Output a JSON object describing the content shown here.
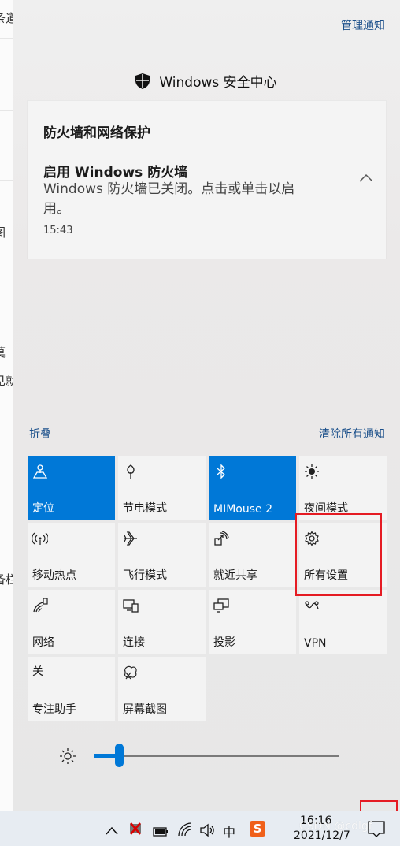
{
  "background_window": {
    "fragments": [
      "条道",
      "图",
      "莫",
      "见就",
      "备栏"
    ]
  },
  "header": {
    "manage_label": "管理通知"
  },
  "security": {
    "app_title": "Windows 安全中心",
    "card_title": "防火墙和网络保护",
    "notification": {
      "title": "启用 Windows 防火墙",
      "body": "Windows 防火墙已关闭。点击或单击以启用。",
      "time": "15:43"
    }
  },
  "actions": {
    "collapse_label": "折叠",
    "clear_label": "清除所有通知"
  },
  "quick_actions": [
    {
      "label": "定位",
      "icon": "location-icon",
      "active": true
    },
    {
      "label": "节电模式",
      "icon": "battery-saver-icon",
      "active": false
    },
    {
      "label": "MIMouse 2",
      "icon": "bluetooth-icon",
      "active": true
    },
    {
      "label": "夜间模式",
      "icon": "night-light-icon",
      "active": false
    },
    {
      "label": "移动热点",
      "icon": "mobile-hotspot-icon",
      "active": false
    },
    {
      "label": "飞行模式",
      "icon": "airplane-icon",
      "active": false
    },
    {
      "label": "就近共享",
      "icon": "nearby-share-icon",
      "active": false
    },
    {
      "label": "所有设置",
      "icon": "gear-icon",
      "active": false
    },
    {
      "label": "网络",
      "icon": "network-icon",
      "active": false
    },
    {
      "label": "连接",
      "icon": "connect-icon",
      "active": false
    },
    {
      "label": "投影",
      "icon": "project-icon",
      "active": false
    },
    {
      "label": "VPN",
      "icon": "vpn-icon",
      "active": false
    },
    {
      "label": "专注助手",
      "icon": "focus-assist-icon",
      "active": false,
      "icon_text": "关"
    },
    {
      "label": "屏幕截图",
      "icon": "screen-snip-icon",
      "active": false
    }
  ],
  "brightness": {
    "level": 0.1
  },
  "taskbar": {
    "ime_label": "中",
    "sogou_label": "S",
    "time": "16:16",
    "date": "2021/12/7"
  },
  "watermark": "CSDN @cdlgf",
  "colors": {
    "accent": "#0078d7",
    "highlight": "#e51b23",
    "link": "#1b4f8a"
  }
}
